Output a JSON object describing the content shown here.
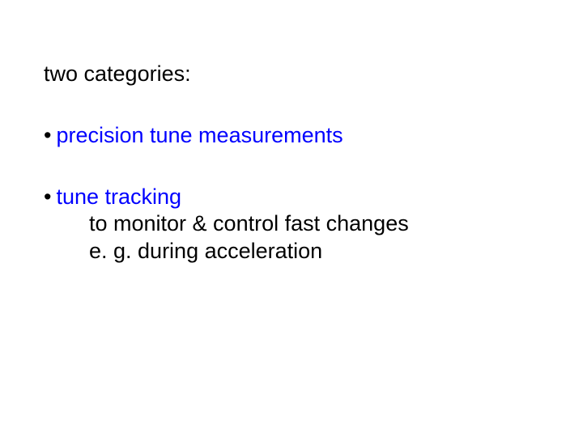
{
  "doc": {
    "heading": "two categories:",
    "items": [
      {
        "bullet": "•",
        "prefix": "",
        "highlight": "precision tune measurements"
      },
      {
        "bullet": "•",
        "prefix": "",
        "highlight": "tune tracking",
        "sub": [
          "to monitor & control fast changes",
          "e. g. during acceleration"
        ]
      }
    ]
  }
}
